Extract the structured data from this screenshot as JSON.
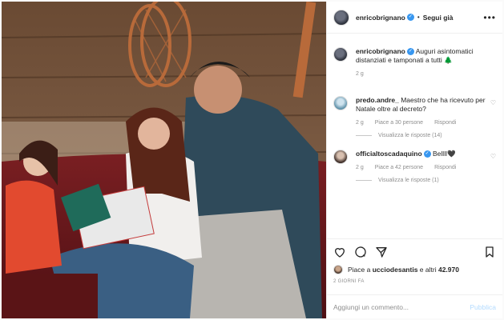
{
  "header": {
    "username": "enricobrignano",
    "separator": "•",
    "follow_label": "Segui già",
    "more_label": "•••"
  },
  "caption": {
    "username": "enricobrignano",
    "text": " Auguri asintomatici distanziati e tamponati a tutti 🌲",
    "time": "2 g"
  },
  "comments": [
    {
      "username": "predo.andre_",
      "text": " Maestro che ha ricevuto per Natale oltre al decreto?",
      "time": "2 g",
      "likes": "Piace a 30 persone",
      "reply": "Rispondi",
      "view_replies": "Visualizza le risposte (14)"
    },
    {
      "username": "officialtoscadaquino",
      "text": " Bellll🖤",
      "time": "2 g",
      "likes": "Piace a 42 persone",
      "reply": "Rispondi",
      "view_replies": "Visualizza le risposte (1)"
    }
  ],
  "likes_summary": {
    "prefix": "Piace a ",
    "user": "ucciodesantis",
    "suffix": " e altri ",
    "count": "42.970"
  },
  "date": "2 GIORNI FA",
  "add_comment": {
    "placeholder": "Aggiungi un commento...",
    "publish_label": "Pubblica"
  },
  "icons": [
    "like-icon",
    "comment-icon",
    "share-icon",
    "bookmark-icon",
    "heart-icon"
  ],
  "colors": {
    "verified": "#3897f0",
    "muted": "#8e8e8e",
    "publish_disabled": "#b3dbff"
  }
}
